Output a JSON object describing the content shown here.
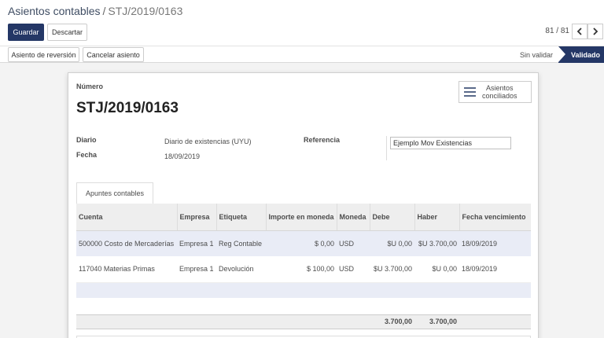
{
  "breadcrumb": {
    "parent": "Asientos contables",
    "separator": "/",
    "current": "STJ/2019/0163"
  },
  "actions": {
    "save": "Guardar",
    "discard": "Descartar"
  },
  "pager": {
    "value": "81 / 81",
    "prev_icon": "chevron-left-icon",
    "next_icon": "chevron-right-icon"
  },
  "header_buttons": {
    "reversal": "Asiento de reversión",
    "cancel": "Cancelar asiento"
  },
  "statusbar": {
    "draft": "Sin validar",
    "posted": "Validado"
  },
  "form": {
    "number_label": "Número",
    "number": "STJ/2019/0163",
    "smart_button": {
      "label_line1": "Asientos",
      "label_line2": "conciliados",
      "icon": "list-icon"
    },
    "journal_label": "Diario",
    "journal": "Diario de existencias (UYU)",
    "date_label": "Fecha",
    "date": "18/09/2019",
    "ref_label": "Referencia",
    "ref": "Ejemplo Mov Existencias"
  },
  "tab": {
    "label": "Apuntes contables"
  },
  "table": {
    "columns": [
      "Cuenta",
      "Empresa",
      "Etiqueta",
      "Importe en moneda",
      "Moneda",
      "Debe",
      "Haber",
      "Fecha vencimiento"
    ],
    "rows": [
      {
        "account": "500000 Costo de Mercaderías",
        "company": "Empresa 1",
        "label": "Reg Contable",
        "amount_currency": "$ 0,00",
        "currency": "USD",
        "debit": "$U 0,00",
        "credit": "$U 3.700,00",
        "due": "18/09/2019"
      },
      {
        "account": "117040 Materias Primas",
        "company": "Empresa 1",
        "label": "Devolución",
        "amount_currency": "$ 100,00",
        "currency": "USD",
        "debit": "$U 3.700,00",
        "credit": "$U 0,00",
        "due": "18/09/2019"
      }
    ],
    "totals": {
      "debit": "3.700,00",
      "credit": "3.700,00"
    }
  },
  "colors": {
    "primary": "#243766",
    "selected_row": "#e9ecf6"
  }
}
